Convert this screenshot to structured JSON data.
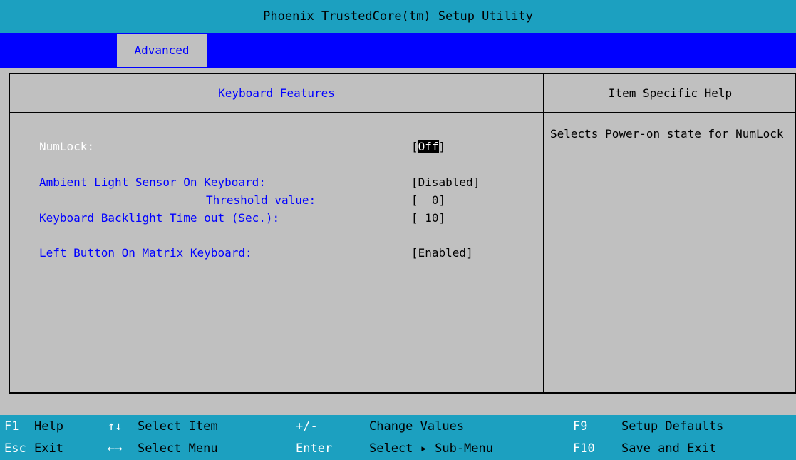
{
  "window": {
    "title": "Phoenix TrustedCore(tm) Setup Utility"
  },
  "menu": {
    "active_tab": "Advanced"
  },
  "panel": {
    "left_title": "Keyboard Features",
    "right_title": "Item Specific Help",
    "settings": [
      {
        "label": "NumLock:",
        "value_prefix": "[",
        "value": "Off",
        "value_suffix": "]"
      },
      {
        "label": "Ambient Light Sensor On Keyboard:",
        "value": "[Disabled]"
      },
      {
        "label": "Threshold value:",
        "value": "[  0]"
      },
      {
        "label": "Keyboard Backlight Time out (Sec.):",
        "value": "[ 10]"
      },
      {
        "label": "Left Button On Matrix Keyboard:",
        "value": "[Enabled]"
      }
    ],
    "help_text": "Selects Power-on state for NumLock"
  },
  "footer": {
    "rows": [
      [
        {
          "key": "F1",
          "text": "Help"
        },
        {
          "key": "↑↓",
          "text": "Select Item"
        },
        {
          "key": "+/-",
          "text": "Change Values"
        },
        {
          "key": "F9",
          "text": "Setup Defaults"
        }
      ],
      [
        {
          "key": "Esc",
          "text": "Exit"
        },
        {
          "key": "←→",
          "text": "Select Menu"
        },
        {
          "key": "Enter",
          "text": "Select ▸ Sub-Menu"
        },
        {
          "key": "F10",
          "text": "Save and Exit"
        }
      ]
    ]
  },
  "colors": {
    "title_bg": "#1ca0c0",
    "menu_bg": "#0000ff",
    "panel_bg": "#c0c0c0",
    "label_color": "#0000ff"
  }
}
